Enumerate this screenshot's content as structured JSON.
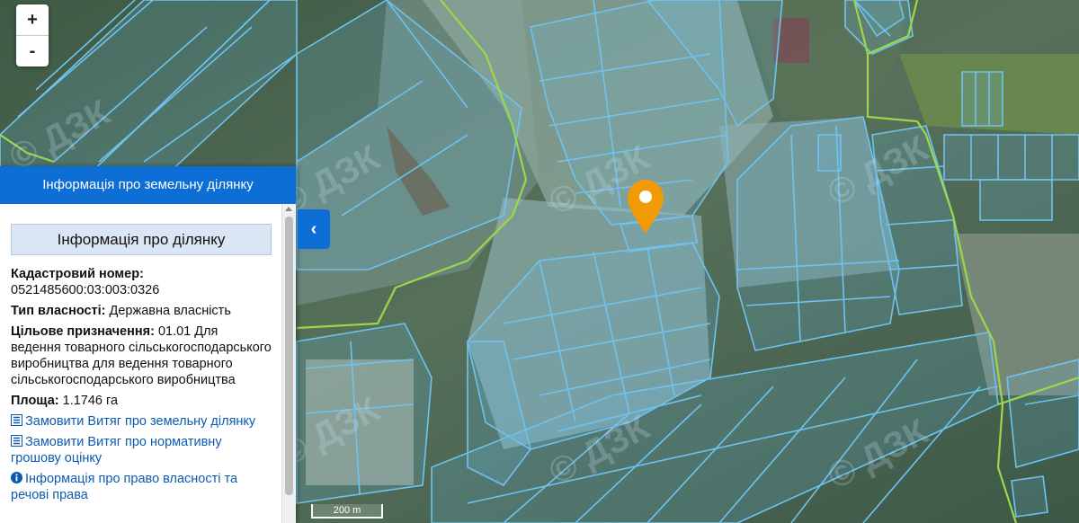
{
  "map": {
    "zoom_in_label": "+",
    "zoom_out_label": "-",
    "scale_label": "200 m",
    "watermark_text": "© ДЗК",
    "marker_color": "#f29a05",
    "parcel_color": "#6ec3f0"
  },
  "panel": {
    "header_title": "Інформація про земельну ділянку",
    "section_title": "Інформація про ділянку",
    "cadastral_label": "Кадастровий номер:",
    "cadastral_value": "0521485600:03:003:0326",
    "ownership_label": "Тип власності:",
    "ownership_value": "Державна власність",
    "purpose_label": "Цільове призначення:",
    "purpose_value": "01.01 Для ведення товарного сільськогосподарського виробництва для ведення товарного сільськогосподарського виробництва",
    "area_label": "Площа:",
    "area_value": "1.1746 га",
    "links": [
      "Замовити Витяг про земельну ділянку",
      "Замовити Витяг про нормативну грошову оцінку",
      "Інформація про право власності та речові права"
    ],
    "toggle_icon": "‹"
  }
}
